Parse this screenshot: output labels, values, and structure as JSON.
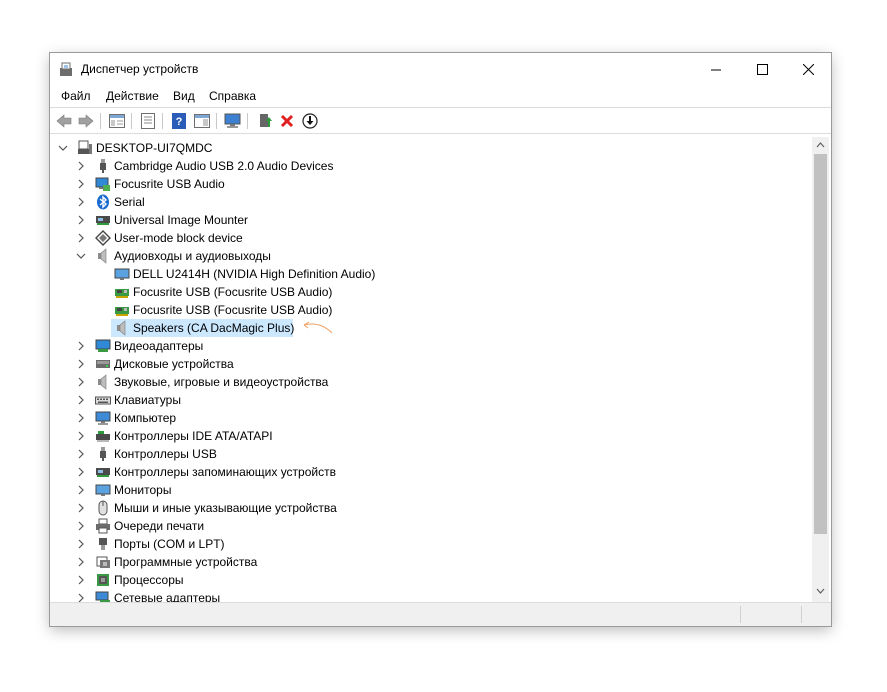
{
  "window": {
    "title": "Диспетчер устройств"
  },
  "menu": [
    "Файл",
    "Действие",
    "Вид",
    "Справка"
  ],
  "tree": {
    "root": "DESKTOP-UI7QMDC",
    "items": [
      {
        "label": "Cambridge Audio USB 2.0 Audio Devices",
        "icon": "usb-plug-icon",
        "expanded": false
      },
      {
        "label": "Focusrite USB Audio",
        "icon": "monitor-network-icon",
        "expanded": false
      },
      {
        "label": "Serial",
        "icon": "bluetooth-icon",
        "expanded": false
      },
      {
        "label": "Universal Image Mounter",
        "icon": "storage-controller-icon",
        "expanded": false
      },
      {
        "label": "User-mode block device",
        "icon": "block-device-icon",
        "expanded": false
      },
      {
        "label": "Аудиовходы и аудиовыходы",
        "icon": "speaker-icon",
        "expanded": true
      },
      {
        "label": "Видеоадаптеры",
        "icon": "display-adapter-icon",
        "expanded": false
      },
      {
        "label": "Дисковые устройства",
        "icon": "disk-drive-icon",
        "expanded": false
      },
      {
        "label": "Звуковые, игровые и видеоустройства",
        "icon": "speaker-icon",
        "expanded": false
      },
      {
        "label": "Клавиатуры",
        "icon": "keyboard-icon",
        "expanded": false
      },
      {
        "label": "Компьютер",
        "icon": "computer-icon",
        "expanded": false
      },
      {
        "label": "Контроллеры IDE ATA/ATAPI",
        "icon": "ide-controller-icon",
        "expanded": false
      },
      {
        "label": "Контроллеры USB",
        "icon": "usb-plug-icon",
        "expanded": false
      },
      {
        "label": "Контроллеры запоминающих устройств",
        "icon": "storage-controller-icon",
        "expanded": false
      },
      {
        "label": "Мониторы",
        "icon": "monitor-icon",
        "expanded": false
      },
      {
        "label": "Мыши и иные указывающие устройства",
        "icon": "mouse-icon",
        "expanded": false
      },
      {
        "label": "Очереди печати",
        "icon": "printer-icon",
        "expanded": false
      },
      {
        "label": "Порты (COM и LPT)",
        "icon": "port-icon",
        "expanded": false
      },
      {
        "label": "Программные устройства",
        "icon": "software-device-icon",
        "expanded": false
      },
      {
        "label": "Процессоры",
        "icon": "processor-icon",
        "expanded": false
      },
      {
        "label": "Сетевые адаптеры",
        "icon": "network-adapter-icon",
        "expanded": false
      }
    ],
    "audio_children": [
      {
        "label": "DELL U2414H (NVIDIA High Definition Audio)",
        "icon": "monitor-icon"
      },
      {
        "label": "Focusrite USB (Focusrite USB Audio)",
        "icon": "audio-card-icon"
      },
      {
        "label": "Focusrite USB (Focusrite USB Audio)",
        "icon": "audio-card-icon"
      },
      {
        "label": "Speakers (CA DacMagic Plus)",
        "icon": "speaker-icon",
        "selected": true
      }
    ]
  },
  "colors": {
    "selection": "#cce8ff",
    "accent_arrow": "#f0a060"
  }
}
